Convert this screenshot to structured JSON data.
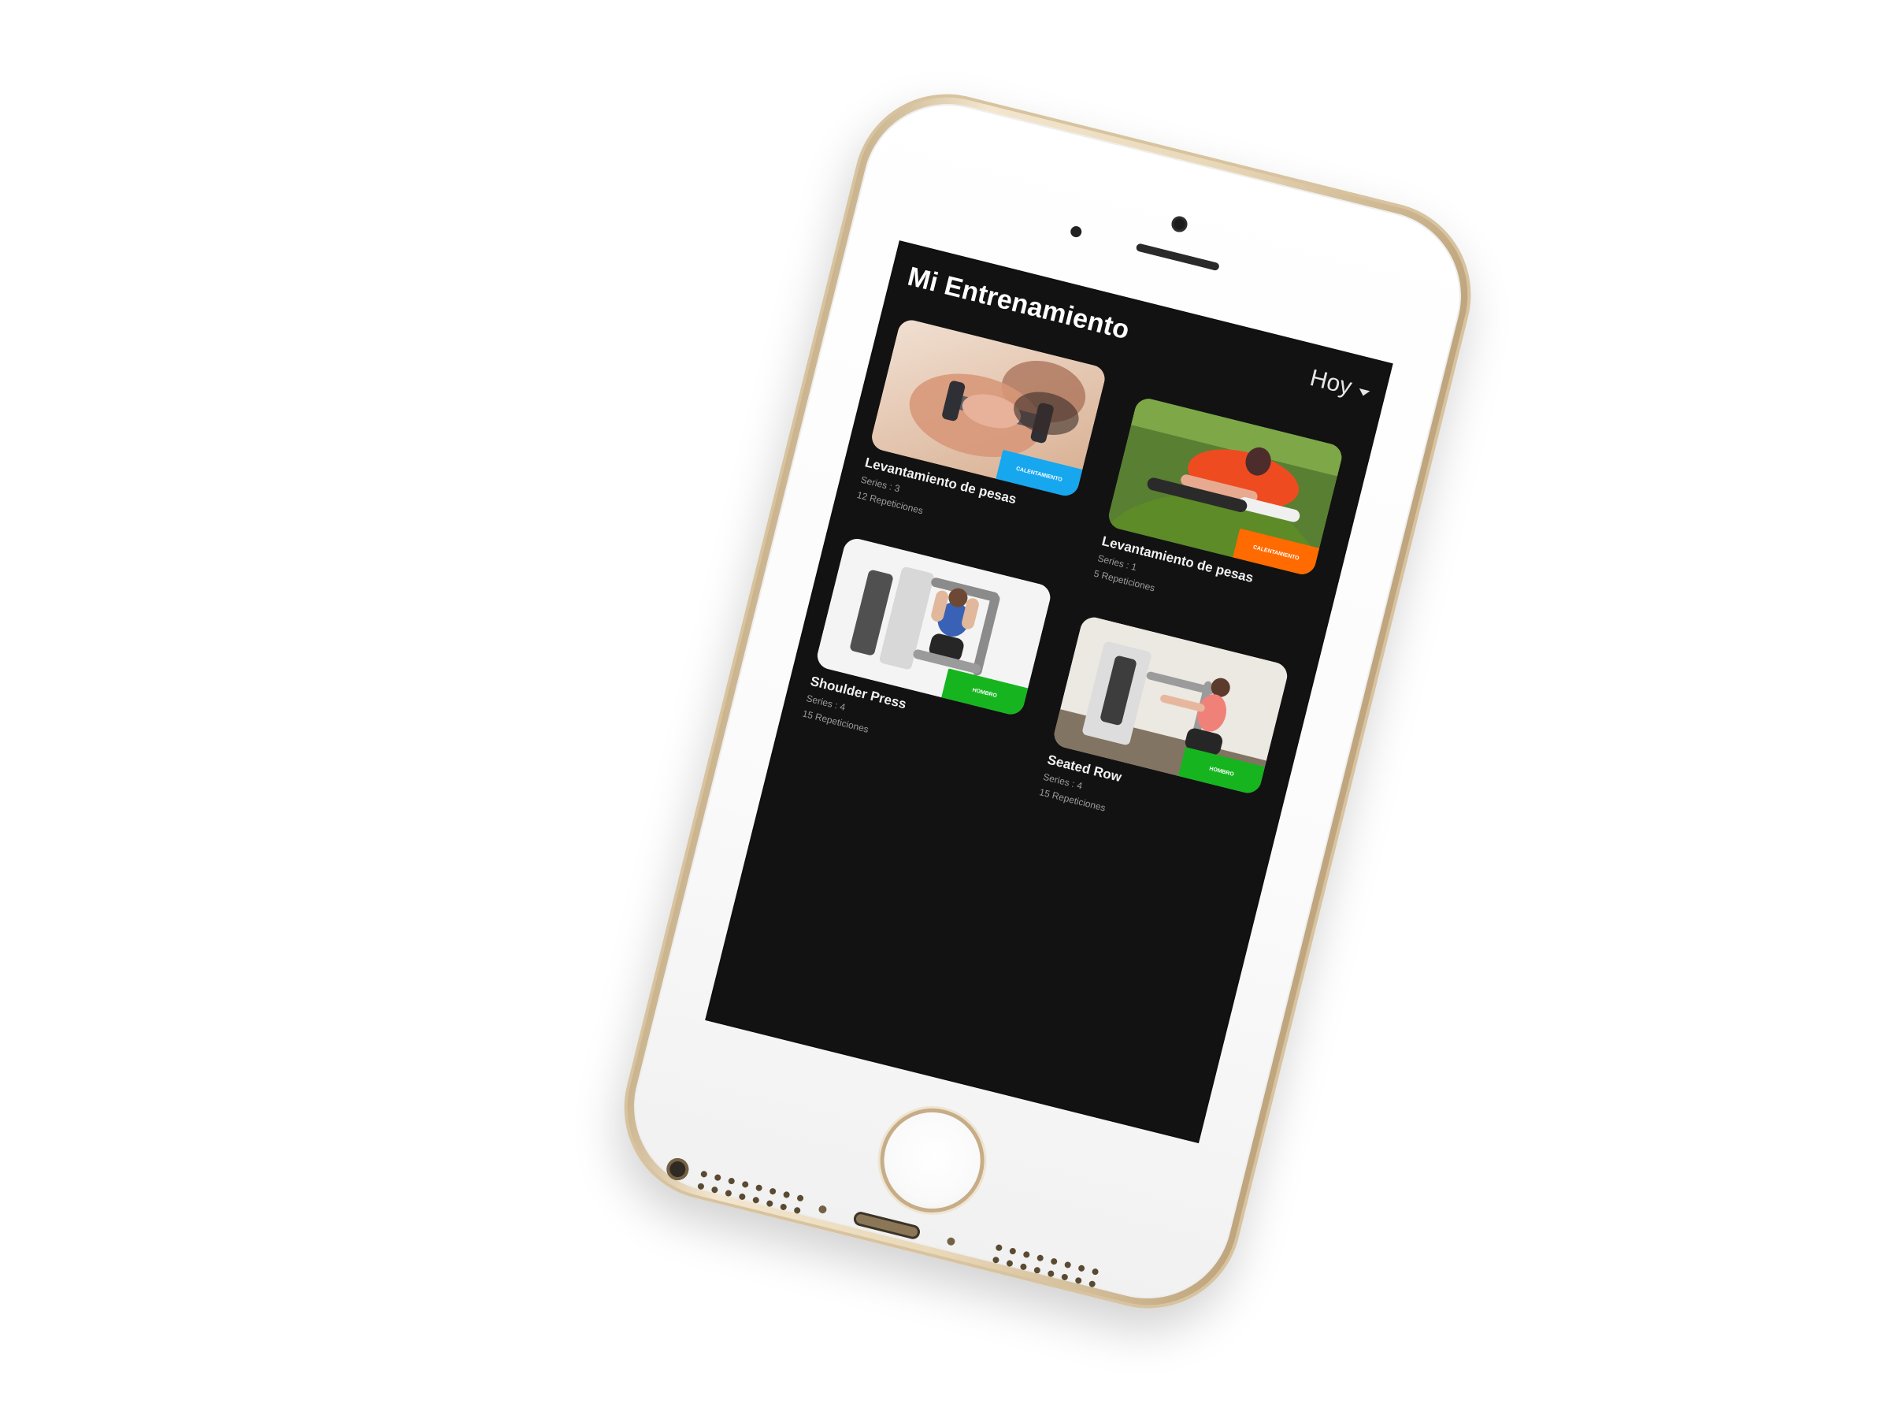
{
  "header": {
    "title": "Mi Entrenamiento",
    "period_label": "Hoy"
  },
  "workouts": [
    {
      "title": "Levantamiento de pesas",
      "series": "Series : 3",
      "repetitions": "12 Repeticiones",
      "tag": "CALENTAMIENTO",
      "tag_color": "#16a7ef"
    },
    {
      "title": "Levantamiento de pesas",
      "series": "Series : 1",
      "repetitions": "5 Repeticiones",
      "tag": "CALENTAMIENTO",
      "tag_color": "#ff6b00"
    },
    {
      "title": "Shoulder Press",
      "series": "Series : 4",
      "repetitions": "15 Repeticiones",
      "tag": "HOMBRO",
      "tag_color": "#16b51f"
    },
    {
      "title": "Seated Row",
      "series": "Series : 4",
      "repetitions": "15 Repeticiones",
      "tag": "HOMBRO",
      "tag_color": "#16b51f"
    }
  ],
  "icons": {
    "period_dropdown": "caret-down-icon",
    "device_home": "home-button-icon"
  }
}
